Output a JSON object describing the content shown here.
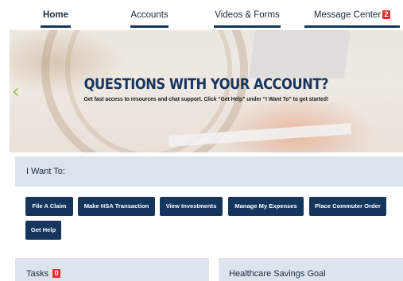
{
  "nav": {
    "items": [
      {
        "label": "Home"
      },
      {
        "label": "Accounts"
      },
      {
        "label": "Videos & Forms"
      },
      {
        "label": "Message Center",
        "badge": "2"
      }
    ]
  },
  "hero": {
    "title": "QUESTIONS WITH YOUR ACCOUNT?",
    "subtitle": "Get fast access to resources and chat support. Click “Get Help” under “I Want To” to get started!",
    "prev_glyph": "‹"
  },
  "want": {
    "title": "I Want To:",
    "buttons": [
      {
        "label": "File A Claim"
      },
      {
        "label": "Make HSA Transaction"
      },
      {
        "label": "View Investments"
      },
      {
        "label": "Manage My Expenses"
      },
      {
        "label": "Place Commuter Order"
      },
      {
        "label": "Get Help"
      }
    ]
  },
  "panels": {
    "tasks": {
      "title": "Tasks",
      "badge": "0"
    },
    "goal": {
      "title": "Healthcare Savings Goal"
    }
  },
  "colors": {
    "brand_navy": "#14365c",
    "badge_red": "#e0322a",
    "panel_bg": "#dde4ee",
    "carousel_arrow": "#8cc63f"
  }
}
